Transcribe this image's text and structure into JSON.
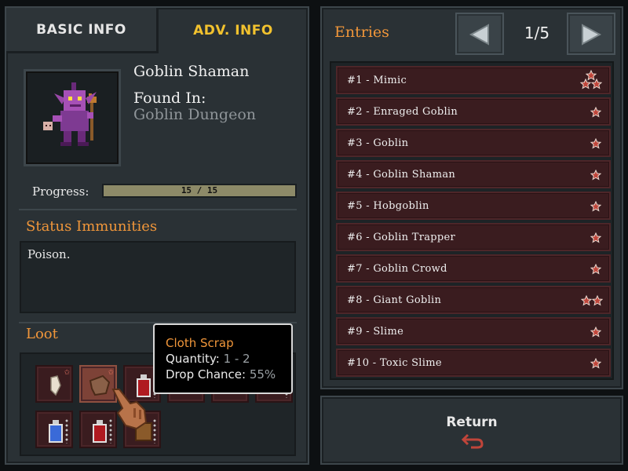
{
  "tabs": {
    "basic": "BASIC INFO",
    "advanced": "ADV. INFO"
  },
  "monster": {
    "name": "Goblin Shaman",
    "found_label": "Found In:",
    "found_value": "Goblin Dungeon"
  },
  "progress": {
    "label": "Progress:",
    "text": "15 / 15",
    "fraction": 1.0
  },
  "immunities": {
    "title": "Status Immunities",
    "text": "Poison."
  },
  "loot": {
    "title": "Loot",
    "slots": [
      {
        "item": "tooth-icon",
        "selected": false,
        "badge": "star"
      },
      {
        "item": "cloth-scrap-icon",
        "selected": true,
        "badge": "star"
      },
      {
        "item": "red-potion-icon",
        "selected": false,
        "badge": "dots"
      },
      {
        "item": "hidden",
        "selected": false,
        "badge": ""
      },
      {
        "item": "hidden",
        "selected": false,
        "badge": ""
      },
      {
        "item": "hidden",
        "selected": false,
        "badge": "dots"
      },
      {
        "item": "blue-potion-icon",
        "selected": false,
        "badge": "dots"
      },
      {
        "item": "red-potion-icon",
        "selected": false,
        "badge": "dots"
      },
      {
        "item": "scroll-icon",
        "selected": false,
        "badge": "dots"
      }
    ]
  },
  "tooltip": {
    "title": "Cloth Scrap",
    "quantity_label": "Quantity: ",
    "quantity_value": "1 - 2",
    "drop_label": "Drop Chance: ",
    "drop_value": "55%"
  },
  "entries": {
    "title": "Entries",
    "page": "1/5",
    "items": [
      {
        "label": "#1 - Mimic",
        "stars": 3
      },
      {
        "label": "#2 - Enraged Goblin",
        "stars": 1
      },
      {
        "label": "#3 - Goblin",
        "stars": 1
      },
      {
        "label": "#4 - Goblin Shaman",
        "stars": 1
      },
      {
        "label": "#5 - Hobgoblin",
        "stars": 1
      },
      {
        "label": "#6 - Goblin Trapper",
        "stars": 1
      },
      {
        "label": "#7 - Goblin Crowd",
        "stars": 1
      },
      {
        "label": "#8 - Giant Goblin",
        "stars": 2
      },
      {
        "label": "#9 - Slime",
        "stars": 1
      },
      {
        "label": "#10 - Toxic Slime",
        "stars": 1
      }
    ]
  },
  "return_label": "Return",
  "colors": {
    "accent_orange": "#f0963a",
    "tab_active": "#f2c22e",
    "row_bg": "#3a1c1f",
    "star": "#c0453a"
  }
}
